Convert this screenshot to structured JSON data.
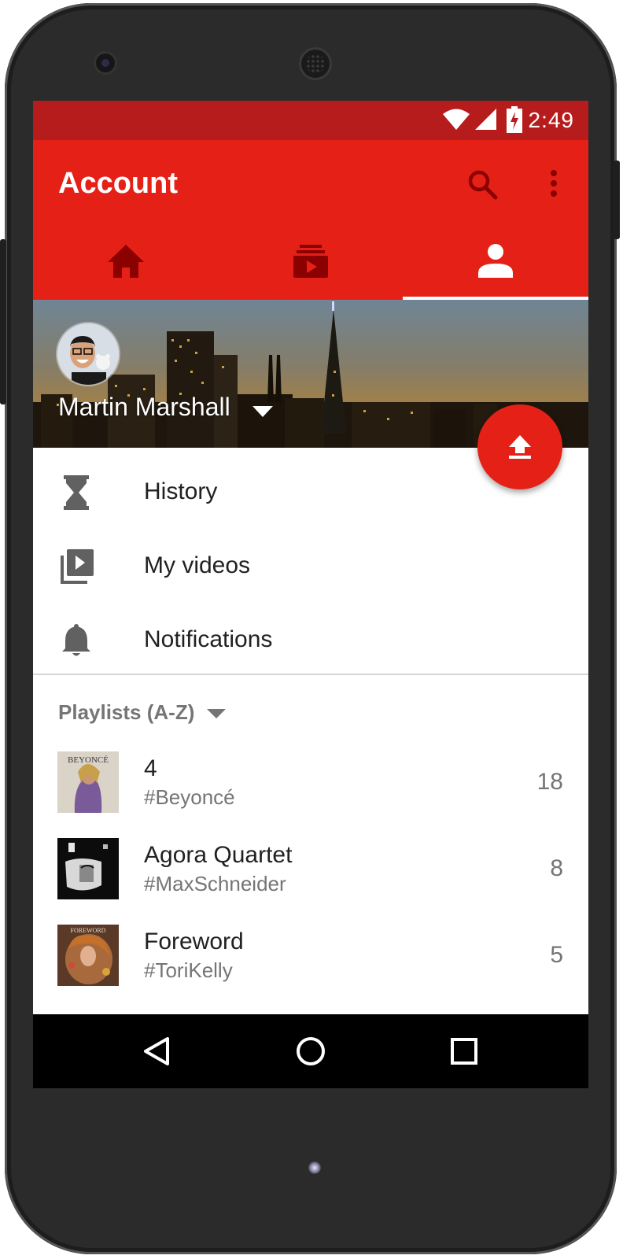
{
  "status_bar": {
    "time": "2:49"
  },
  "toolbar": {
    "title": "Account"
  },
  "tabs": [
    {
      "icon": "home-icon",
      "selected": false
    },
    {
      "icon": "subscriptions-icon",
      "selected": false
    },
    {
      "icon": "account-icon",
      "selected": true
    }
  ],
  "profile": {
    "name": "Martin Marshall"
  },
  "menu": [
    {
      "label": "History",
      "icon": "hourglass-icon"
    },
    {
      "label": "My videos",
      "icon": "video-library-icon"
    },
    {
      "label": "Notifications",
      "icon": "bell-icon"
    }
  ],
  "playlists": {
    "header": "Playlists (A-Z)",
    "items": [
      {
        "title": "4",
        "subtitle": "#Beyoncé",
        "count": "18",
        "cover_text": "BEYONCÉ"
      },
      {
        "title": "Agora Quartet",
        "subtitle": "#MaxSchneider",
        "count": "8"
      },
      {
        "title": "Foreword",
        "subtitle": "#ToriKelly",
        "count": "5",
        "cover_text": "FOREWORD"
      }
    ]
  },
  "colors": {
    "primary": "#e52117",
    "status_bar": "#b71c1c",
    "tab_inactive": "#8b0000"
  }
}
